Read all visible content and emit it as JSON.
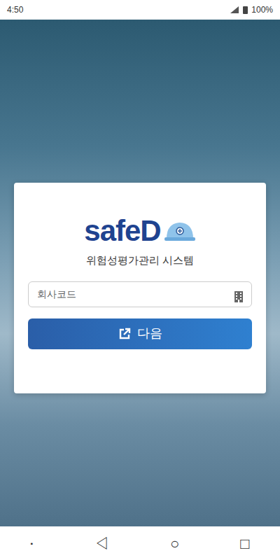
{
  "status_bar": {
    "time": "4:50",
    "battery": "100%"
  },
  "login": {
    "logo": "safeD",
    "subtitle": "위험성평가관리 시스템",
    "company_code": {
      "placeholder": "회사코드"
    },
    "next_button": "다음"
  },
  "nav_bar": {
    "buttons": [
      "▪",
      "◁",
      "○",
      "□"
    ]
  }
}
